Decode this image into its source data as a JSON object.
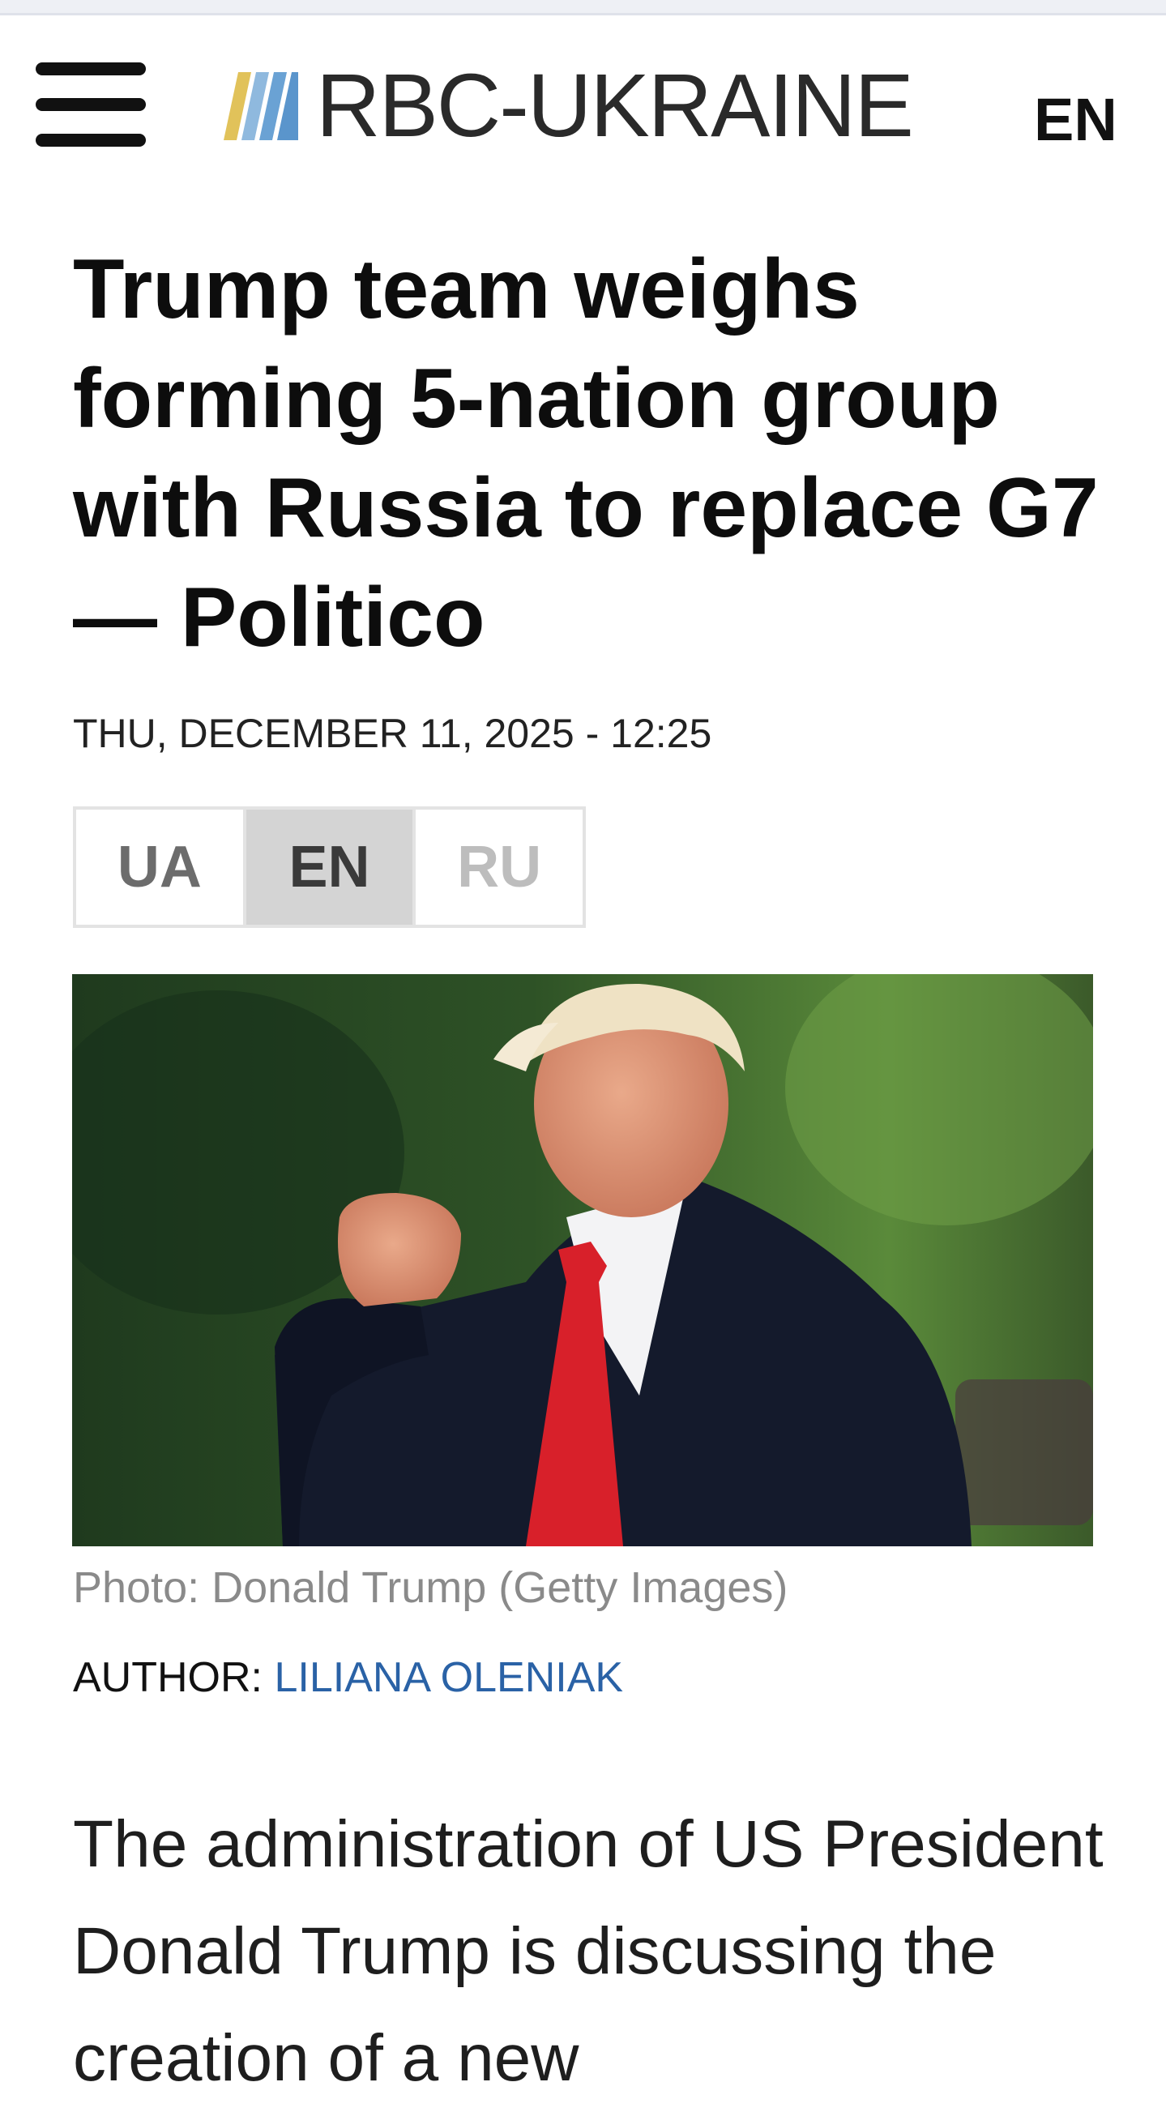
{
  "header": {
    "brand": "RBC-UKRAINE",
    "language": "EN"
  },
  "article": {
    "headline": "Trump team weighs forming 5-nation group with Russia to replace G7 — Politico",
    "date": "THU, DECEMBER 11, 2025 - 12:25",
    "languages": [
      {
        "code": "UA",
        "active": false
      },
      {
        "code": "EN",
        "active": true
      },
      {
        "code": "RU",
        "active": false
      }
    ],
    "photo_caption": "Photo: Donald Trump (Getty Images)",
    "author_label": "AUTHOR: ",
    "author_name": "LILIANA OLENIAK",
    "lead": "The administration of US President Donald Trump is discussing the creation of a new"
  },
  "colors": {
    "author_link": "#2a62a6",
    "active_lang_bg": "#d4d4d4"
  }
}
